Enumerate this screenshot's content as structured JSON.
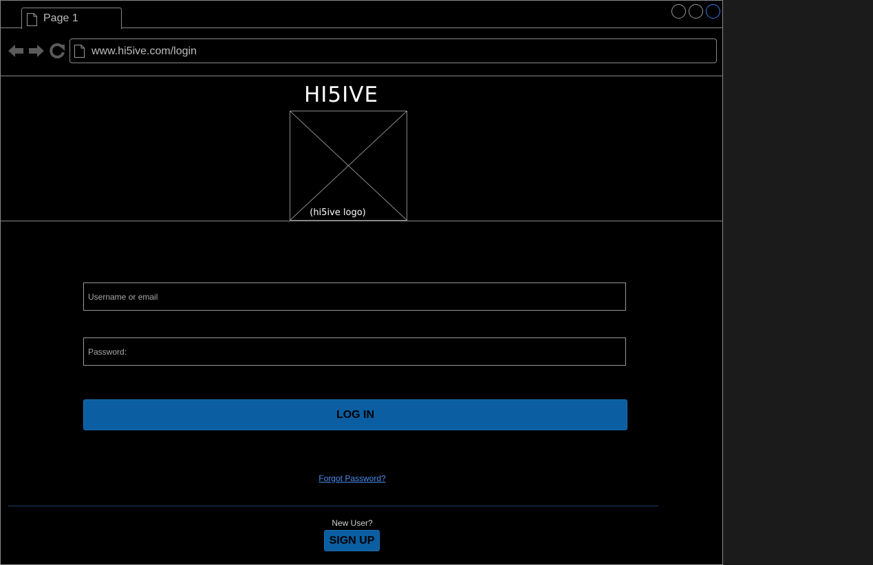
{
  "browser": {
    "tab_label": "Page 1",
    "url": "www.hi5ive.com/login",
    "window_controls": [
      "circle-button",
      "circle-button",
      "circle-button"
    ],
    "accent_color": "#3b7ee8"
  },
  "header": {
    "brand_title": "HI5IVE",
    "logo_caption": "(hi5ive logo)"
  },
  "login_form": {
    "username_placeholder": "Username or email",
    "password_placeholder": "Password:",
    "login_label": "LOG IN",
    "forgot_link": "Forgot Password?",
    "button_color": "#0a5ea1",
    "link_color": "#4a8ff0"
  },
  "signup": {
    "prompt": "New User?",
    "signup_label": "SIGN UP"
  }
}
